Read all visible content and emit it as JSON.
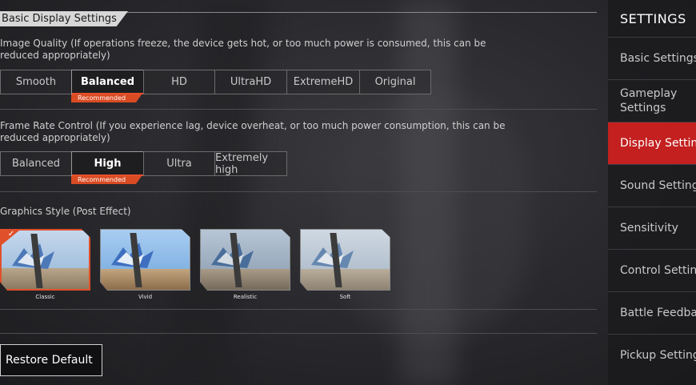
{
  "section_title": "Basic Display Settings",
  "image_quality": {
    "label": "Image Quality (If operations freeze, the device gets hot, or too much power is consumed, this can be reduced appropriately)",
    "options": [
      "Smooth",
      "Balanced",
      "HD",
      "UltraHD",
      "ExtremeHD",
      "Original"
    ],
    "selected": "Balanced",
    "recommended_label": "Recommended"
  },
  "frame_rate": {
    "label": "Frame Rate Control (If you experience lag, device overheat, or too much power consumption, this can be reduced appropriately)",
    "options": [
      "Balanced",
      "High",
      "Ultra",
      "Extremely high"
    ],
    "selected": "High",
    "recommended_label": "Recommended"
  },
  "graphics_style": {
    "label": "Graphics Style (Post Effect)",
    "styles": [
      "Classic",
      "Vivid",
      "Realistic",
      "Soft"
    ],
    "selected": "Classic"
  },
  "restore_button": "Restore Default",
  "sidebar": {
    "title": "SETTINGS",
    "items": [
      "Basic Settings",
      "Gameplay Settings",
      "Display Settings",
      "Sound Settings",
      "Sensitivity",
      "Control Settings",
      "Battle Feedback",
      "Pickup Settings"
    ],
    "active": "Display Settings"
  },
  "colors": {
    "accent": "#e0502a",
    "active_nav": "#c3201f"
  }
}
